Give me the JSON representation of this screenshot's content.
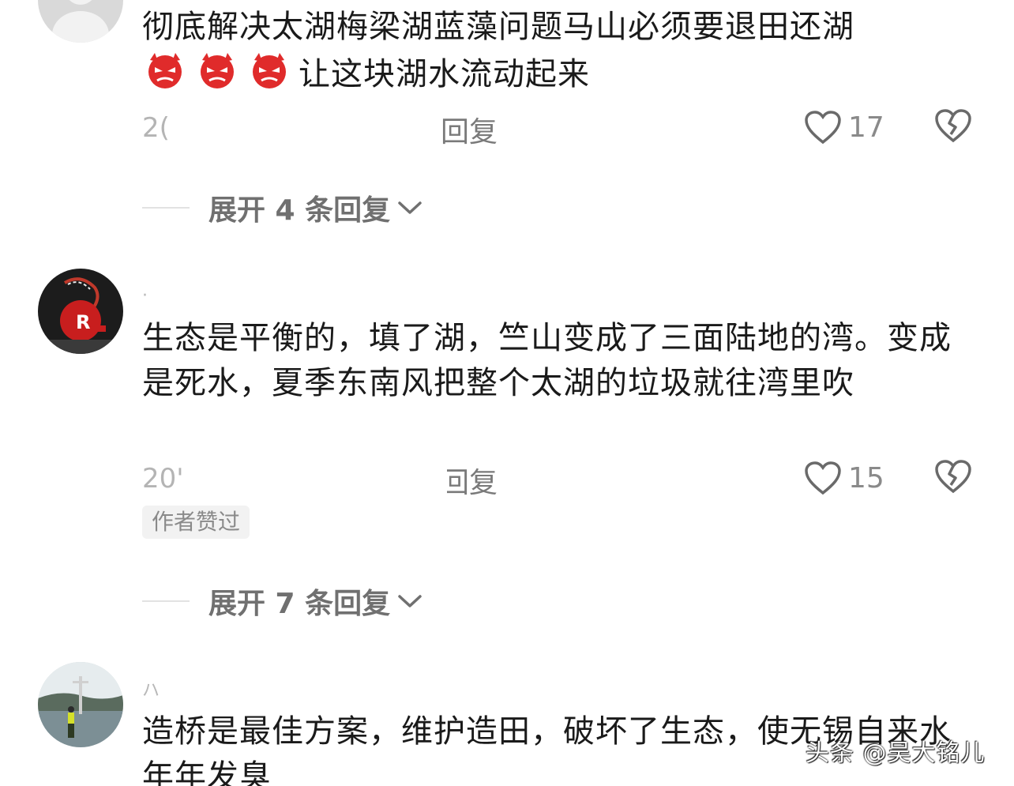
{
  "comments": [
    {
      "username": "",
      "text_line1": "彻底解决太湖梅梁湖蓝藻问题马山必须要退田还湖",
      "emoji": [
        "angry-devil-emoji",
        "angry-devil-emoji",
        "angry-devil-emoji"
      ],
      "text_line2": "让这块湖水流动起来",
      "date": "2(",
      "reply_label": "回复",
      "like_count": "17",
      "expand_label": "展开 4 条回复"
    },
    {
      "username": "·",
      "text": "生态是平衡的，填了湖，竺山变成了三面陆地的湾。变成是死水，夏季东南风把整个太湖的垃圾就往湾里吹",
      "date": "20'",
      "reply_label": "回复",
      "like_count": "15",
      "badge": "作者赞过",
      "expand_label": "展开 7 条回复"
    },
    {
      "username": "ハ",
      "text": "造桥是最佳方案，维护造田，破坏了生态，使无锡自来水年年发臭"
    }
  ],
  "watermark": "头条 @吴大铭儿",
  "colors": {
    "text": "#1a1a1a",
    "meta": "#b4b4b4",
    "emoji_red": "#e02b2b"
  }
}
